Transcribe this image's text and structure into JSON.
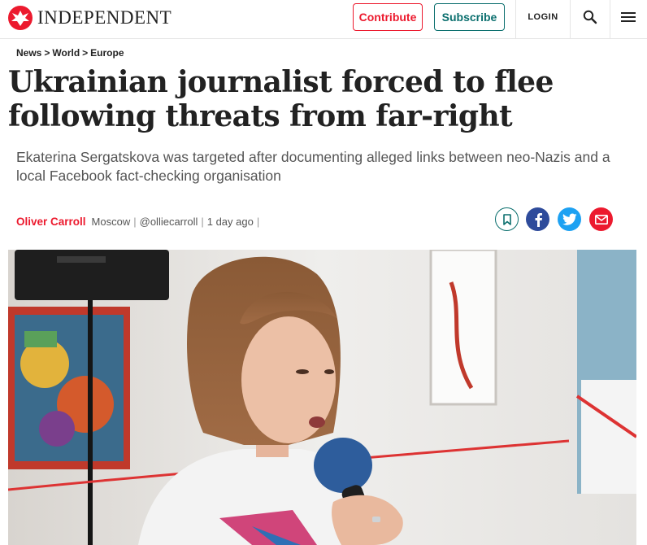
{
  "header": {
    "logo_text": "INDEPENDENT",
    "contribute_label": "Contribute",
    "subscribe_label": "Subscribe",
    "login_label": "LOGIN",
    "search_icon": "search-icon",
    "menu_icon": "hamburger-menu-icon"
  },
  "breadcrumb": {
    "items": [
      "News",
      "World",
      "Europe"
    ],
    "separator": ">"
  },
  "article": {
    "headline": "Ukrainian journalist forced to flee following threats from far-right",
    "standfirst": "Ekaterina Sergatskova was targeted after documenting alleged links between neo-Nazis and a local Facebook fact-checking organisation",
    "author": "Oliver Carroll",
    "location": "Moscow",
    "handle": "@olliecarroll",
    "time": "1 day ago",
    "divider": "|"
  },
  "share": {
    "icons": [
      "bookmark-icon",
      "facebook-icon",
      "twitter-icon",
      "email-icon"
    ]
  },
  "colors": {
    "brand_red": "#ec1a2e",
    "subscribe_teal": "#0b6f6e",
    "facebook_blue": "#2e4b9b",
    "twitter_blue": "#1da1f2"
  }
}
